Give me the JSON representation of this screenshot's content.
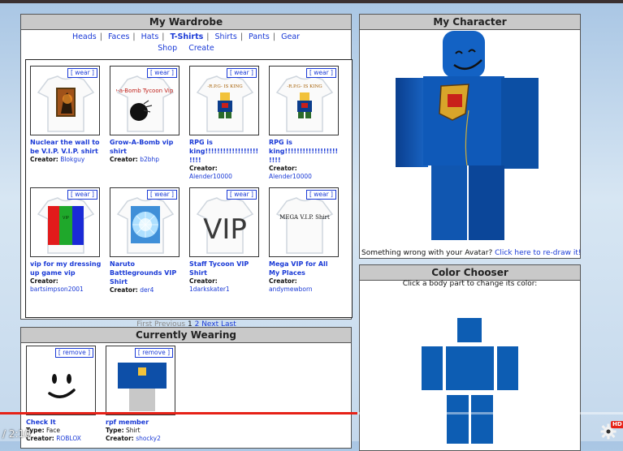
{
  "wardrobe": {
    "title": "My Wardrobe",
    "tabs": [
      "Heads",
      "Faces",
      "Hats",
      "T-Shirts",
      "Shirts",
      "Pants",
      "Gear"
    ],
    "selected_tab": "T-Shirts",
    "links": [
      "Shop",
      "Create"
    ],
    "wear_label": "[ wear ]",
    "creator_label": "Creator:",
    "items": [
      {
        "name": "Nuclear the wall to be V.I.P. V.I.P. shirt",
        "creator": "Blokguy"
      },
      {
        "name": "Grow-A-Bomb vip shirt",
        "creator": "b2bhp",
        "art": "Grow-a-Bomb Tycoon Vip Shirt"
      },
      {
        "name": "RPG is king!!!!!!!!!!!!!!!!!!!!!!",
        "creator": "Alender10000",
        "art": "-R.P.G- IS KING"
      },
      {
        "name": "RPG is king!!!!!!!!!!!!!!!!!!!!!!",
        "creator": "Alender10000",
        "art": "-R.P.G- IS KING"
      },
      {
        "name": "vip for my dressing up game vip",
        "creator": "bartsimpson2001",
        "art": "VIP"
      },
      {
        "name": "Naruto Battlegrounds VIP Shirt",
        "creator": "der4"
      },
      {
        "name": "Staff Tycoon VIP Shirt",
        "creator": "1darkskater1",
        "art": "VIP"
      },
      {
        "name": "Mega VIP for All My Places",
        "creator": "andymewborn",
        "art": "MEGA V.I.P. Shirt"
      }
    ],
    "pager": {
      "first": "First",
      "previous": "Previous",
      "page1": "1",
      "page2": "2",
      "next": "Next",
      "last": "Last"
    }
  },
  "wearing": {
    "title": "Currently Wearing",
    "remove_label": "[ remove ]",
    "type_label": "Type:",
    "creator_label": "Creator:",
    "items": [
      {
        "name": "Check It",
        "type": "Face",
        "creator": "ROBLOX"
      },
      {
        "name": "rpf member",
        "type": "Shirt",
        "creator": "shocky2"
      }
    ]
  },
  "character": {
    "title": "My Character",
    "message": "Something wrong with your Avatar?",
    "redraw_link": "Click here to re-draw it!"
  },
  "color_chooser": {
    "title": "Color Chooser",
    "instruction": "Click a body part to change its color:",
    "part_color": "#0d5db3"
  },
  "player": {
    "time": "/ 2:10",
    "hd_badge": "HD",
    "progress_color": "#e62117"
  }
}
